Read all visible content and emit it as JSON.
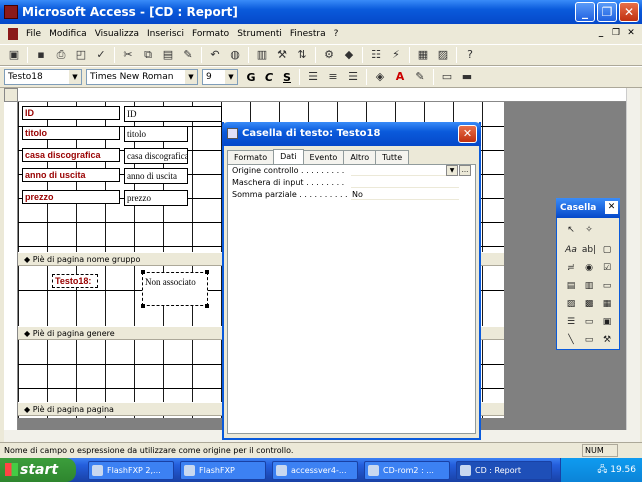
{
  "window": {
    "title": "Microsoft Access - [CD : Report]",
    "min": "_",
    "max": "❐",
    "close": "✕"
  },
  "menu": [
    "File",
    "Modifica",
    "Visualizza",
    "Inserisci",
    "Formato",
    "Strumenti",
    "Finestra",
    "?"
  ],
  "format_bar": {
    "object": "Testo18",
    "font": "Times New Roman",
    "size": "9",
    "bold": "G",
    "italic": "C",
    "underline": "S"
  },
  "report": {
    "labels": [
      "ID",
      "titolo",
      "casa discografica",
      "anno di uscita",
      "prezzo"
    ],
    "fields": [
      "ID",
      "titolo",
      "casa discografica",
      "anno di uscita",
      "prezzo"
    ],
    "sections": [
      "Piè di pagina nome gruppo",
      "Piè di pagina genere",
      "Piè di pagina pagina"
    ],
    "group_label": "Testo18:",
    "group_field": "Non associato"
  },
  "dialog": {
    "title": "Casella di testo: Testo18",
    "tabs": [
      "Formato",
      "Dati",
      "Evento",
      "Altro",
      "Tutte"
    ],
    "selected_tab": "Dati",
    "properties": [
      {
        "name": "Origine controllo . . . . . . . . .",
        "value": ""
      },
      {
        "name": "Maschera di input . . . . . . . .",
        "value": ""
      },
      {
        "name": "Somma parziale . . . . . . . . . .",
        "value": "No"
      }
    ]
  },
  "toolbox": {
    "title": "Casella"
  },
  "status": {
    "text": "Nome di campo o espressione da utilizzare come origine per il controllo.",
    "num": "NUM"
  },
  "taskbar": {
    "start": "start",
    "tasks": [
      "FlashFXP 2,...",
      "FlashFXP",
      "accessver4-...",
      "CD-rom2 : ...",
      "CD : Report"
    ],
    "clock": "19.56"
  }
}
